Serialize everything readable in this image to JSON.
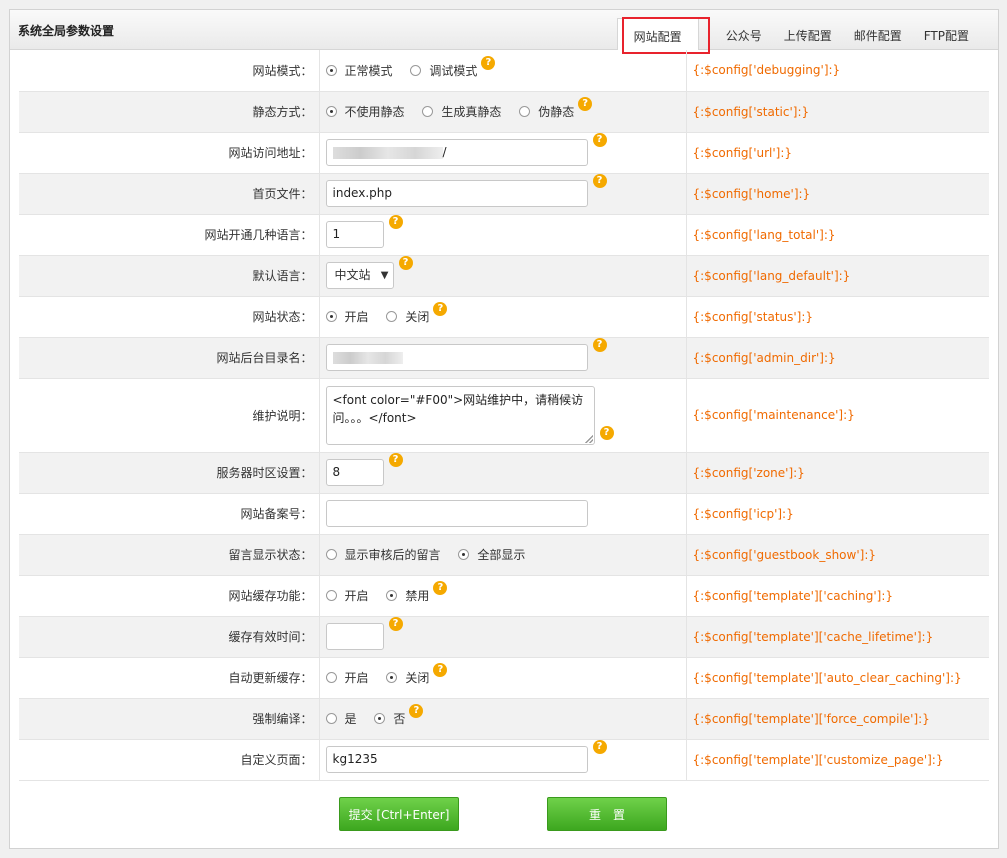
{
  "panel": {
    "title": "系统全局参数设置"
  },
  "tabs": [
    {
      "label": "网站配置",
      "active": true
    },
    {
      "label": "公众号"
    },
    {
      "label": "上传配置"
    },
    {
      "label": "邮件配置"
    },
    {
      "label": "FTP配置"
    }
  ],
  "colors": {
    "accent_green": "#4cb82b",
    "var_orange": "#f06a00",
    "highlight_red": "#e8232d",
    "help_orange": "#f5a900"
  },
  "rows": [
    {
      "label": "网站模式：",
      "options": [
        "正常模式",
        "调试模式"
      ],
      "selected": 0,
      "var": "{:$config['debugging']:}"
    },
    {
      "label": "静态方式：",
      "options": [
        "不使用静态",
        "生成真静态",
        "伪静态"
      ],
      "selected": 0,
      "var": "{:$config['static']:}"
    },
    {
      "label": "网站访问地址：",
      "value": "/",
      "var": "{:$config['url']:}"
    },
    {
      "label": "首页文件：",
      "value": "index.php",
      "var": "{:$config['home']:}"
    },
    {
      "label": "网站开通几种语言：",
      "value": "1",
      "var": "{:$config['lang_total']:}"
    },
    {
      "label": "默认语言：",
      "value": "中文站",
      "var": "{:$config['lang_default']:}"
    },
    {
      "label": "网站状态：",
      "options": [
        "开启",
        "关闭"
      ],
      "selected": 0,
      "var": "{:$config['status']:}"
    },
    {
      "label": "网站后台目录名：",
      "value": "",
      "var": "{:$config['admin_dir']:}"
    },
    {
      "label": "维护说明：",
      "value": "<font color=\"#F00\">网站维护中，请稍候访问。。。</font>",
      "var": "{:$config['maintenance']:}"
    },
    {
      "label": "服务器时区设置：",
      "value": "8",
      "var": "{:$config['zone']:}"
    },
    {
      "label": "网站备案号：",
      "value": "",
      "var": "{:$config['icp']:}"
    },
    {
      "label": "留言显示状态：",
      "options": [
        "显示审核后的留言",
        "全部显示"
      ],
      "selected": 1,
      "var": "{:$config['guestbook_show']:}"
    },
    {
      "label": "网站缓存功能：",
      "options": [
        "开启",
        "禁用"
      ],
      "selected": 1,
      "var": "{:$config['template']['caching']:}"
    },
    {
      "label": "缓存有效时间：",
      "value": "",
      "var": "{:$config['template']['cache_lifetime']:}"
    },
    {
      "label": "自动更新缓存：",
      "options": [
        "开启",
        "关闭"
      ],
      "selected": 1,
      "var": "{:$config['template']['auto_clear_caching']:}"
    },
    {
      "label": "强制编译：",
      "options": [
        "是",
        "否"
      ],
      "selected": 1,
      "var": "{:$config['template']['force_compile']:}"
    },
    {
      "label": "自定义页面：",
      "value": "kg1235",
      "var": "{:$config['template']['customize_page']:}"
    }
  ],
  "buttons": {
    "submit": "提交 [Ctrl+Enter]",
    "reset": "重置"
  },
  "help_glyph": "?"
}
